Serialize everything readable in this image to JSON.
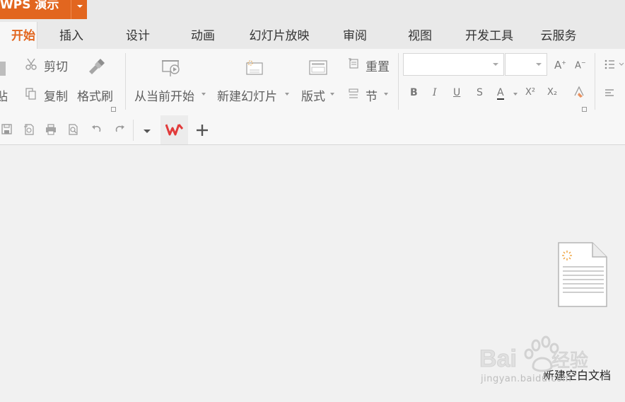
{
  "app": {
    "title": "WPS 演示"
  },
  "tabs": [
    {
      "label": "开始"
    },
    {
      "label": "插入"
    },
    {
      "label": "设计"
    },
    {
      "label": "动画"
    },
    {
      "label": "幻灯片放映"
    },
    {
      "label": "审阅"
    },
    {
      "label": "视图"
    },
    {
      "label": "开发工具"
    },
    {
      "label": "云服务"
    }
  ],
  "ribbon": {
    "paste_partial": "贴",
    "cut": "剪切",
    "copy": "复制",
    "format_painter": "格式刷",
    "from_current": "从当前开始",
    "new_slide": "新建幻灯片",
    "layout": "版式",
    "reset": "重置",
    "section": "节",
    "font_name": "",
    "font_size": "",
    "format_buttons": {
      "bold": "B",
      "italic": "I",
      "underline": "U",
      "strike": "S",
      "font_color": "A",
      "superscript": "X²",
      "subscript": "X₂"
    }
  },
  "quick_access": {
    "icons": [
      "save-icon",
      "export-pdf-icon",
      "print-icon",
      "print-preview-icon",
      "undo-icon",
      "redo-icon",
      "customize-dropdown-icon",
      "wps-logo-icon",
      "new-tab-plus-icon"
    ]
  },
  "canvas": {
    "new_blank_doc_label": "新建空白文档"
  },
  "watermark": {
    "text": "jingyan.baidu.com"
  },
  "colors": {
    "accent": "#e2661f"
  }
}
